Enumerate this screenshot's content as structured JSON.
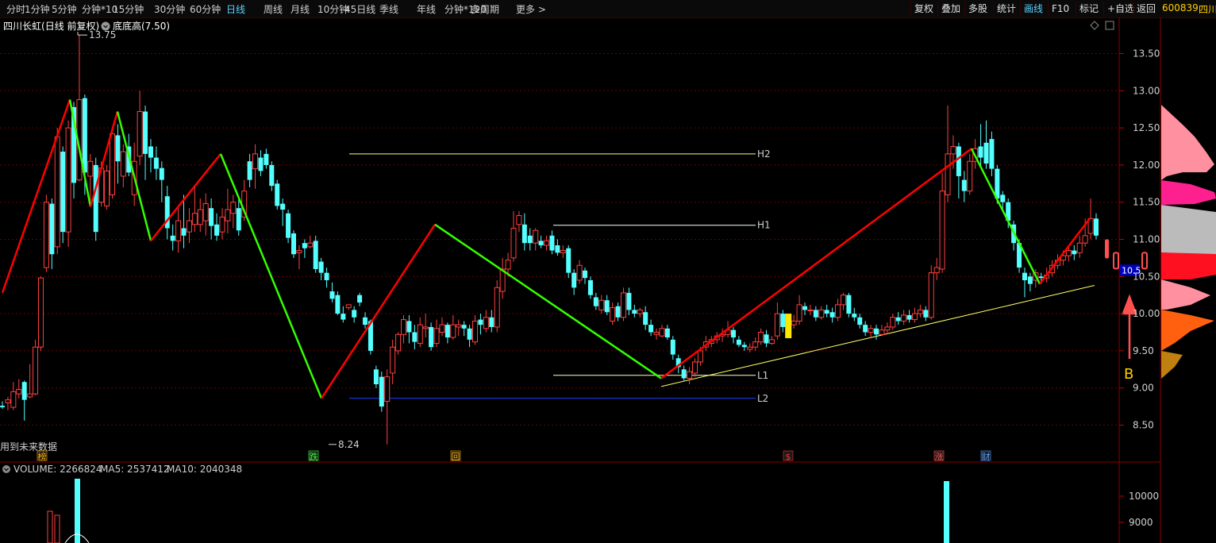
{
  "toolbar": {
    "periods": [
      "分时",
      "1分钟",
      "5分钟",
      "分钟*10",
      "15分钟",
      "30分钟",
      "60分钟",
      "日线",
      "周线",
      "月线",
      "10分钟",
      "45日线",
      "季线",
      "年线",
      "分钟*120",
      "多周期",
      "更多 >"
    ],
    "active_period": "日线",
    "right_buttons": [
      "复权",
      "叠加",
      "多股",
      "统计",
      "画线",
      "F10",
      "标记",
      "+自选",
      "返回"
    ],
    "active_right": "画线",
    "stock_code": "600839",
    "stock_name_fragment": "四川"
  },
  "chart_header": {
    "stock_name": "四川长虹",
    "mode": "(日线 前复权)",
    "indicator": "底底高(7.50)"
  },
  "price_axis": [
    "13.50",
    "13.00",
    "12.50",
    "12.00",
    "11.50",
    "11.00",
    "10.50",
    "10.00",
    "9.50",
    "9.00",
    "8.50"
  ],
  "annotations": {
    "high_price": "13.75",
    "low_price": "8.24",
    "future_data_note": "用到未来数据",
    "current_price_tag": "10.5",
    "arrow_label": "B"
  },
  "horizontal_levels": [
    {
      "label": "H2",
      "price": 12.15
    },
    {
      "label": "H1",
      "price": 11.19
    },
    {
      "label": "L1",
      "price": 9.17
    },
    {
      "label": "L2",
      "price": 8.86
    }
  ],
  "event_markers": [
    "榜",
    "跌",
    "回",
    "$",
    "涨",
    "财"
  ],
  "volume_panel": {
    "label": "VOLUME: 2266824",
    "ma5": "MA5: 2537412",
    "ma10": "MA10: 2040348",
    "axis": [
      "10000",
      "9000"
    ]
  },
  "colors": {
    "up": "#ff4040",
    "down": "#54ffff",
    "zigzag_up": "#ff0000",
    "zigzag_down": "#33ff00",
    "grid": "#6a0000",
    "support": "#ffff66"
  },
  "chart_data": {
    "type": "candlestick",
    "ylim": [
      8.24,
      13.75
    ],
    "zigzag": [
      10.28,
      12.88,
      11.44,
      12.72,
      10.98,
      12.15,
      8.86,
      11.2,
      9.13,
      12.22,
      10.4,
      11.28
    ],
    "candles": [
      [
        8.76,
        8.74,
        8.82,
        8.72
      ],
      [
        8.8,
        8.84,
        8.88,
        8.7
      ],
      [
        8.74,
        8.95,
        9.08,
        8.7
      ],
      [
        8.92,
        8.98,
        9.12,
        8.86
      ],
      [
        9.08,
        8.84,
        9.1,
        8.56
      ],
      [
        8.88,
        8.92,
        9.32,
        8.86
      ],
      [
        8.92,
        9.55,
        9.65,
        8.9
      ],
      [
        9.55,
        10.48,
        10.5,
        9.5
      ],
      [
        10.62,
        11.5,
        11.6,
        10.56
      ],
      [
        11.48,
        10.8,
        11.55,
        10.6
      ],
      [
        10.9,
        12.38,
        12.5,
        10.8
      ],
      [
        12.18,
        11.1,
        12.25,
        10.95
      ],
      [
        11.1,
        12.5,
        12.6,
        10.9
      ],
      [
        12.78,
        11.76,
        12.85,
        11.55
      ],
      [
        11.8,
        12.88,
        13.75,
        11.78
      ],
      [
        12.9,
        11.9,
        12.95,
        11.6
      ],
      [
        11.85,
        12.05,
        12.15,
        11.52
      ],
      [
        12.0,
        11.1,
        12.1,
        10.98
      ],
      [
        11.5,
        11.96,
        12.05,
        11.44
      ],
      [
        11.45,
        11.92,
        12.0,
        11.4
      ],
      [
        11.6,
        12.42,
        12.5,
        11.55
      ],
      [
        12.4,
        12.05,
        12.55,
        11.75
      ],
      [
        11.85,
        12.18,
        12.28,
        11.7
      ],
      [
        12.25,
        11.9,
        12.42,
        11.85
      ],
      [
        11.6,
        12.05,
        12.3,
        11.45
      ],
      [
        12.12,
        12.72,
        13.0,
        12.0
      ],
      [
        12.72,
        12.15,
        12.8,
        11.8
      ],
      [
        12.25,
        12.1,
        12.35,
        11.9
      ],
      [
        12.1,
        11.95,
        12.25,
        11.8
      ],
      [
        11.96,
        11.8,
        12.05,
        11.5
      ],
      [
        11.58,
        11.15,
        11.72,
        11.0
      ],
      [
        11.05,
        10.98,
        11.2,
        10.85
      ],
      [
        10.98,
        11.25,
        11.42,
        10.82
      ],
      [
        11.15,
        11.05,
        11.6,
        10.88
      ],
      [
        11.1,
        11.25,
        11.42,
        10.95
      ],
      [
        11.2,
        11.35,
        11.72,
        11.1
      ],
      [
        11.2,
        11.4,
        11.55,
        11.1
      ],
      [
        11.25,
        11.48,
        11.62,
        11.05
      ],
      [
        11.42,
        11.18,
        11.55,
        11.0
      ],
      [
        11.2,
        11.05,
        11.35,
        10.98
      ],
      [
        11.1,
        11.3,
        11.42,
        11.0
      ],
      [
        11.25,
        11.4,
        11.68,
        11.08
      ],
      [
        11.35,
        11.5,
        11.6,
        11.15
      ],
      [
        11.42,
        11.12,
        11.55,
        11.05
      ],
      [
        11.3,
        11.65,
        11.8,
        11.25
      ],
      [
        12.05,
        11.8,
        12.15,
        11.7
      ],
      [
        11.95,
        12.15,
        12.28,
        11.68
      ],
      [
        12.1,
        11.92,
        12.2,
        11.85
      ],
      [
        12.15,
        12.0,
        12.22,
        11.95
      ],
      [
        12.0,
        11.72,
        12.05,
        11.65
      ],
      [
        11.75,
        11.45,
        11.8,
        11.4
      ],
      [
        11.48,
        11.4,
        11.55,
        11.18
      ],
      [
        11.35,
        11.02,
        11.4,
        10.95
      ],
      [
        11.08,
        10.8,
        11.12,
        10.75
      ],
      [
        10.82,
        10.85,
        10.92,
        10.6
      ],
      [
        10.95,
        10.88,
        11.0,
        10.75
      ],
      [
        10.9,
        10.95,
        11.05,
        10.88
      ],
      [
        10.98,
        10.6,
        11.05,
        10.55
      ],
      [
        10.7,
        10.55,
        10.75,
        10.45
      ],
      [
        10.55,
        10.45,
        10.62,
        10.35
      ],
      [
        10.3,
        10.2,
        10.42,
        10.15
      ],
      [
        10.25,
        10.0,
        10.3,
        9.98
      ],
      [
        10.0,
        9.92,
        10.1,
        9.88
      ],
      [
        10.08,
        10.12,
        10.12,
        10.05
      ],
      [
        10.05,
        9.95,
        10.1,
        9.88
      ],
      [
        10.25,
        10.15,
        10.28,
        10.1
      ],
      [
        9.95,
        9.85,
        10.02,
        9.8
      ],
      [
        9.9,
        9.5,
        9.92,
        9.45
      ],
      [
        9.25,
        9.05,
        9.3,
        9.0
      ],
      [
        9.15,
        8.75,
        9.22,
        8.68
      ],
      [
        8.82,
        9.15,
        9.25,
        8.24
      ],
      [
        9.2,
        9.55,
        9.65,
        9.05
      ],
      [
        9.5,
        9.72,
        9.75,
        9.45
      ],
      [
        9.72,
        9.92,
        9.98,
        9.6
      ],
      [
        9.9,
        9.75,
        9.98,
        9.6
      ],
      [
        9.75,
        9.62,
        9.85,
        9.52
      ],
      [
        9.6,
        9.85,
        9.95,
        9.55
      ],
      [
        9.8,
        9.82,
        10.0,
        9.68
      ],
      [
        9.82,
        9.55,
        9.88,
        9.5
      ],
      [
        9.6,
        9.8,
        9.92,
        9.55
      ],
      [
        9.75,
        9.85,
        9.95,
        9.7
      ],
      [
        9.85,
        9.68,
        9.88,
        9.6
      ],
      [
        9.68,
        9.85,
        9.98,
        9.65
      ],
      [
        9.82,
        9.85,
        9.92,
        9.7
      ],
      [
        9.85,
        9.8,
        9.9,
        9.7
      ],
      [
        9.8,
        9.65,
        9.85,
        9.55
      ],
      [
        9.62,
        9.9,
        9.98,
        9.58
      ],
      [
        9.92,
        9.85,
        10.0,
        9.72
      ],
      [
        9.8,
        9.95,
        10.05,
        9.75
      ],
      [
        9.95,
        9.82,
        10.05,
        9.75
      ],
      [
        9.82,
        10.35,
        10.45,
        9.75
      ],
      [
        10.3,
        10.6,
        10.75,
        10.2
      ],
      [
        10.6,
        10.72,
        10.82,
        10.5
      ],
      [
        10.75,
        11.15,
        11.38,
        10.7
      ],
      [
        11.2,
        11.32,
        11.38,
        11.1
      ],
      [
        11.2,
        10.95,
        11.35,
        10.85
      ],
      [
        11.05,
        10.95,
        11.15,
        10.85
      ],
      [
        10.95,
        11.12,
        11.15,
        10.85
      ],
      [
        10.98,
        10.92,
        11.05,
        10.88
      ],
      [
        10.92,
        10.98,
        11.05,
        10.85
      ],
      [
        11.05,
        10.85,
        11.12,
        10.8
      ],
      [
        10.92,
        10.82,
        11.0,
        10.78
      ],
      [
        10.82,
        10.85,
        10.92,
        10.75
      ],
      [
        10.88,
        10.55,
        10.92,
        10.48
      ],
      [
        10.55,
        10.35,
        10.6,
        10.25
      ],
      [
        10.45,
        10.65,
        10.72,
        10.4
      ],
      [
        10.58,
        10.48,
        10.62,
        10.4
      ],
      [
        10.45,
        10.25,
        10.5,
        10.2
      ],
      [
        10.22,
        10.1,
        10.28,
        10.05
      ],
      [
        10.05,
        10.18,
        10.25,
        10.0
      ],
      [
        10.18,
        10.02,
        10.25,
        9.98
      ],
      [
        9.9,
        10.08,
        10.15,
        9.85
      ],
      [
        10.1,
        9.95,
        10.15,
        9.9
      ],
      [
        9.95,
        10.28,
        10.35,
        9.9
      ],
      [
        10.28,
        10.05,
        10.35,
        9.98
      ],
      [
        10.05,
        10.0,
        10.12,
        9.95
      ],
      [
        10.0,
        10.05,
        10.08,
        9.95
      ],
      [
        10.02,
        9.85,
        10.1,
        9.78
      ],
      [
        9.85,
        9.75,
        9.92,
        9.7
      ],
      [
        9.72,
        9.75,
        9.8,
        9.65
      ],
      [
        9.7,
        9.8,
        9.85,
        9.68
      ],
      [
        9.8,
        9.68,
        9.85,
        9.65
      ],
      [
        9.65,
        9.45,
        9.7,
        9.38
      ],
      [
        9.4,
        9.28,
        9.45,
        9.2
      ],
      [
        9.25,
        9.13,
        9.3,
        9.1
      ],
      [
        9.13,
        9.22,
        9.28,
        9.05
      ],
      [
        9.2,
        9.35,
        9.4,
        9.15
      ],
      [
        9.35,
        9.5,
        9.55,
        9.3
      ],
      [
        9.55,
        9.62,
        9.7,
        9.5
      ],
      [
        9.6,
        9.65,
        9.7,
        9.55
      ],
      [
        9.65,
        9.7,
        9.75,
        9.6
      ],
      [
        9.7,
        9.72,
        9.8,
        9.62
      ],
      [
        9.72,
        9.78,
        9.9,
        9.68
      ],
      [
        9.78,
        9.68,
        9.82,
        9.6
      ],
      [
        9.65,
        9.58,
        9.7,
        9.55
      ],
      [
        9.58,
        9.55,
        9.62,
        9.5
      ],
      [
        9.52,
        9.55,
        9.6,
        9.48
      ],
      [
        9.55,
        9.62,
        9.68,
        9.5
      ],
      [
        9.62,
        9.75,
        9.8,
        9.58
      ],
      [
        9.72,
        9.6,
        9.78,
        9.55
      ],
      [
        9.6,
        9.65,
        9.7,
        9.58
      ],
      [
        9.7,
        10.0,
        10.15,
        9.65
      ],
      [
        10.0,
        9.82,
        10.05,
        9.75
      ],
      [
        9.82,
        9.88,
        9.92,
        9.78
      ],
      [
        9.85,
        9.9,
        9.98,
        9.8
      ],
      [
        9.9,
        10.12,
        10.25,
        9.85
      ],
      [
        10.1,
        10.05,
        10.15,
        9.98
      ],
      [
        10.05,
        10.05,
        10.12,
        9.98
      ],
      [
        10.05,
        9.95,
        10.1,
        9.9
      ],
      [
        9.95,
        10.05,
        10.1,
        9.92
      ],
      [
        10.05,
        10.0,
        10.12,
        9.95
      ],
      [
        10.02,
        9.95,
        10.08,
        9.88
      ],
      [
        9.95,
        10.12,
        10.2,
        9.9
      ],
      [
        10.12,
        10.25,
        10.28,
        10.05
      ],
      [
        10.25,
        10.0,
        10.28,
        9.95
      ],
      [
        10.0,
        9.95,
        10.08,
        9.9
      ],
      [
        9.95,
        9.85,
        10.0,
        9.8
      ],
      [
        9.85,
        9.75,
        9.9,
        9.7
      ],
      [
        9.75,
        9.8,
        9.85,
        9.68
      ],
      [
        9.8,
        9.72,
        9.85,
        9.65
      ],
      [
        9.72,
        9.78,
        9.85,
        9.7
      ],
      [
        9.78,
        9.82,
        9.88,
        9.72
      ],
      [
        9.82,
        9.95,
        10.0,
        9.78
      ],
      [
        9.95,
        9.9,
        10.02,
        9.85
      ],
      [
        9.9,
        9.98,
        10.05,
        9.85
      ],
      [
        9.98,
        9.92,
        10.05,
        9.88
      ],
      [
        9.92,
        10.0,
        10.08,
        9.88
      ],
      [
        10.0,
        10.05,
        10.12,
        9.95
      ],
      [
        10.05,
        9.95,
        10.1,
        9.9
      ],
      [
        9.95,
        10.55,
        10.65,
        9.92
      ],
      [
        10.55,
        10.62,
        10.75,
        10.45
      ],
      [
        10.6,
        11.65,
        11.9,
        10.55
      ],
      [
        11.6,
        12.15,
        12.8,
        11.5
      ],
      [
        12.15,
        12.25,
        12.4,
        11.95
      ],
      [
        12.25,
        11.85,
        12.3,
        11.55
      ],
      [
        11.8,
        11.65,
        11.92,
        11.5
      ],
      [
        11.65,
        12.05,
        12.15,
        11.6
      ],
      [
        12.05,
        12.22,
        12.35,
        11.95
      ],
      [
        12.25,
        12.1,
        12.55,
        12.0
      ],
      [
        12.3,
        12.02,
        12.6,
        11.95
      ],
      [
        12.35,
        11.95,
        12.45,
        11.85
      ],
      [
        11.95,
        11.55,
        12.0,
        11.48
      ],
      [
        11.6,
        11.5,
        11.65,
        11.4
      ],
      [
        11.5,
        11.25,
        11.55,
        11.15
      ],
      [
        11.2,
        10.95,
        11.25,
        10.85
      ],
      [
        10.95,
        10.62,
        11.0,
        10.55
      ],
      [
        10.55,
        10.45,
        10.62,
        10.22
      ],
      [
        10.5,
        10.4,
        10.55,
        10.3
      ],
      [
        10.45,
        10.55,
        10.6,
        10.35
      ],
      [
        10.5,
        10.48,
        10.55,
        10.4
      ],
      [
        10.48,
        10.52,
        10.62,
        10.42
      ],
      [
        10.55,
        10.65,
        10.72,
        10.5
      ],
      [
        10.65,
        10.72,
        10.8,
        10.6
      ],
      [
        10.72,
        10.78,
        10.85,
        10.65
      ],
      [
        10.78,
        10.85,
        10.92,
        10.7
      ],
      [
        10.85,
        10.8,
        10.92,
        10.72
      ],
      [
        10.82,
        10.95,
        11.05,
        10.75
      ],
      [
        10.95,
        11.05,
        11.28,
        10.9
      ],
      [
        11.08,
        11.28,
        11.55,
        11.0
      ],
      [
        11.28,
        11.05,
        11.35,
        11.0
      ]
    ]
  }
}
